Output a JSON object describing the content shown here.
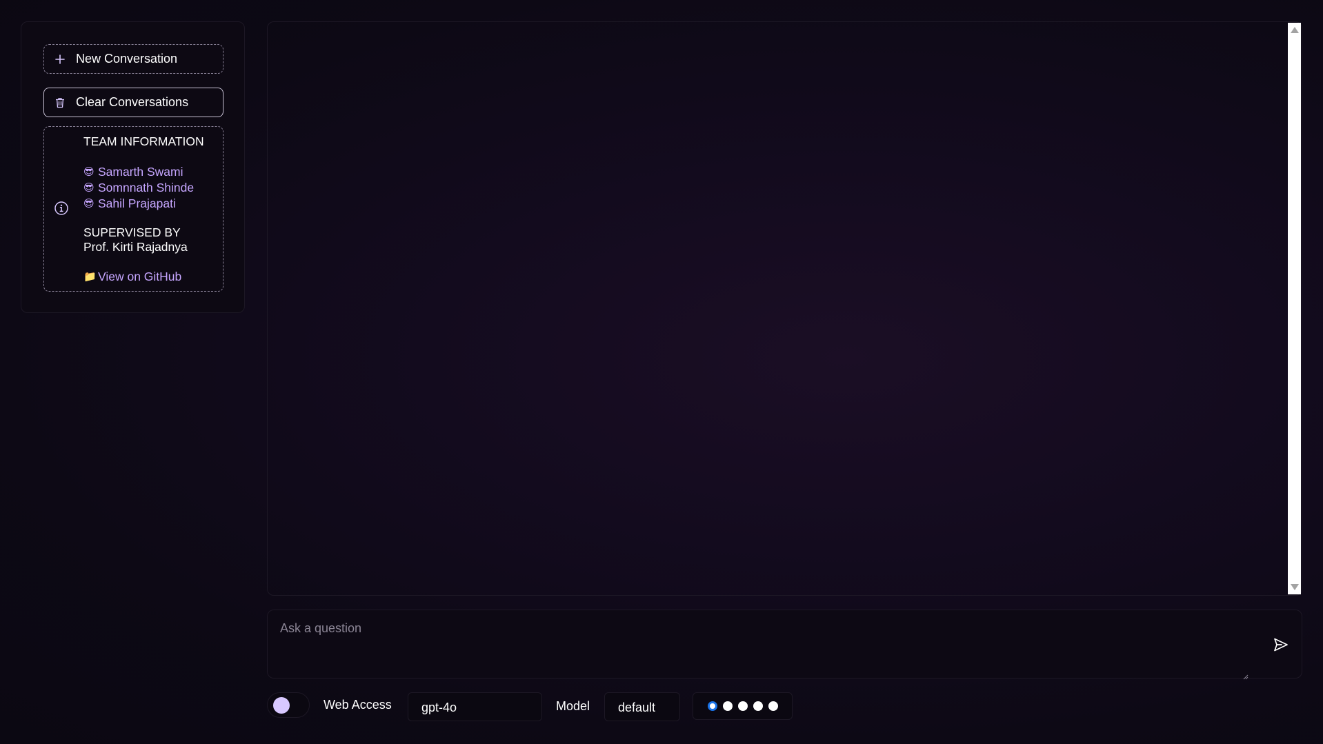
{
  "sidebar": {
    "new_conversation_label": "New Conversation",
    "clear_conversations_label": "Clear Conversations",
    "team": {
      "heading": "TEAM INFORMATION",
      "members": [
        {
          "emoji": "😎",
          "name": "Samarth Swami"
        },
        {
          "emoji": "😎",
          "name": "Somnnath Shinde"
        },
        {
          "emoji": "😎",
          "name": "Sahil Prajapati"
        }
      ],
      "supervised_heading": "SUPERVISED BY",
      "supervisor": "Prof. Kirti Rajadnya",
      "github_emoji": "📁",
      "github_label": "View on GitHub"
    }
  },
  "input": {
    "placeholder": "Ask a question",
    "value": ""
  },
  "controls": {
    "web_access_label": "Web Access",
    "web_access_enabled": false,
    "model_name_value": "gpt-4o",
    "model_label": "Model",
    "model_variant_value": "default",
    "radio_count": 5,
    "radio_selected_index": 0
  },
  "colors": {
    "accent_purple": "#c6a6ff",
    "toggle_knob": "#d8c8ff",
    "radio_selected": "#1a73e8"
  }
}
